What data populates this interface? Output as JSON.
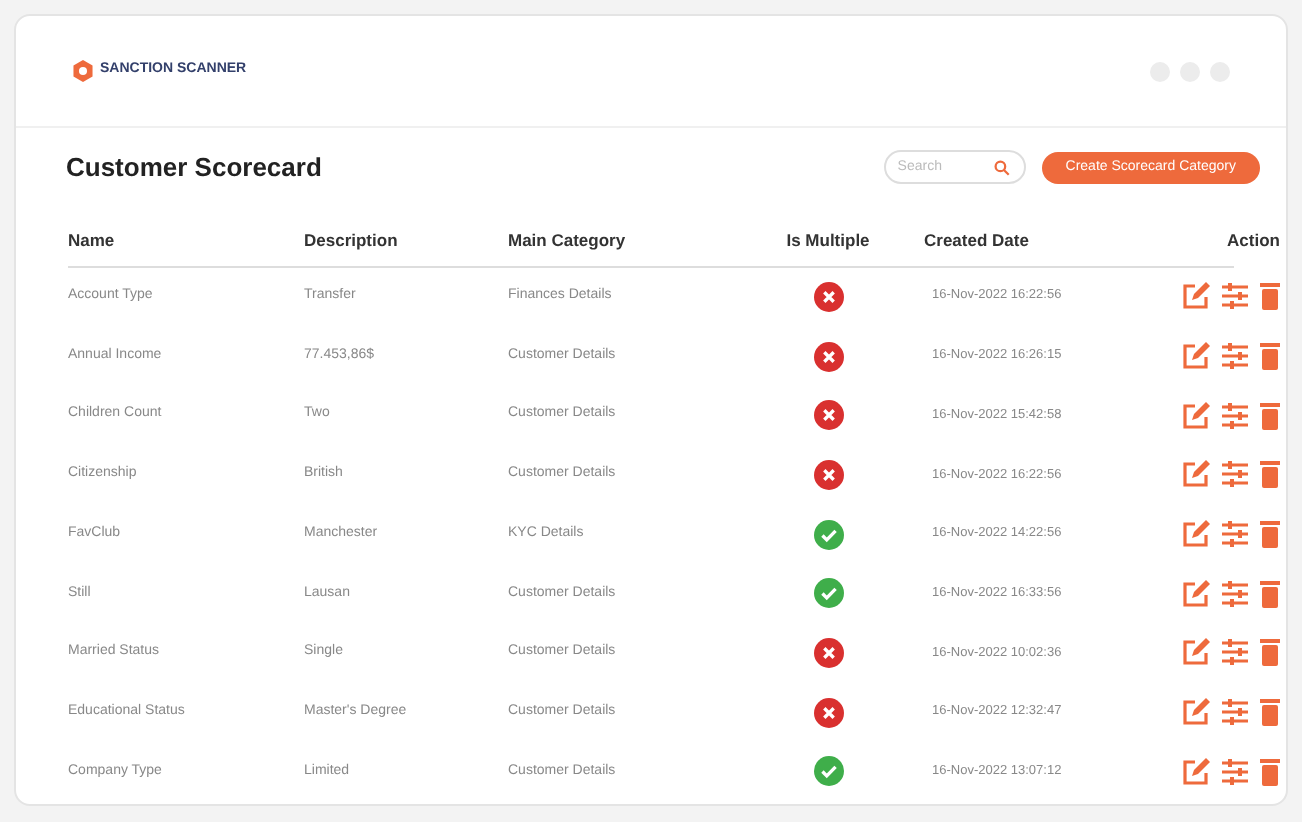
{
  "brand": "SANCTION SCANNER",
  "title": "Customer Scorecard",
  "search": {
    "placeholder": "Search"
  },
  "create_button": "Create Scorecard Category",
  "columns": [
    "Name",
    "Description",
    "Main Category",
    "Is Multiple",
    "Created Date",
    "Action"
  ],
  "rows": [
    {
      "name": "Account Type",
      "description": "Transfer",
      "category": "Finances Details",
      "multiple": false,
      "created": "16-Nov-2022 16:22:56"
    },
    {
      "name": "Annual Income",
      "description": "77.453,86$",
      "category": "Customer Details",
      "multiple": false,
      "created": "16-Nov-2022 16:26:15"
    },
    {
      "name": "Children Count",
      "description": "Two",
      "category": "Customer Details",
      "multiple": false,
      "created": "16-Nov-2022 15:42:58"
    },
    {
      "name": "Citizenship",
      "description": "British",
      "category": "Customer Details",
      "multiple": false,
      "created": "16-Nov-2022 16:22:56"
    },
    {
      "name": "FavClub",
      "description": "Manchester",
      "category": "KYC Details",
      "multiple": true,
      "created": "16-Nov-2022 14:22:56"
    },
    {
      "name": "Still",
      "description": "Lausan",
      "category": "Customer Details",
      "multiple": true,
      "created": "16-Nov-2022 16:33:56"
    },
    {
      "name": "Married Status",
      "description": "Single",
      "category": "Customer Details",
      "multiple": false,
      "created": "16-Nov-2022 10:02:36"
    },
    {
      "name": "Educational Status",
      "description": "Master's Degree",
      "category": "Customer Details",
      "multiple": false,
      "created": "16-Nov-2022 12:32:47"
    },
    {
      "name": "Company Type",
      "description": "Limited",
      "category": "Customer Details",
      "multiple": true,
      "created": "16-Nov-2022 13:07:12"
    }
  ]
}
